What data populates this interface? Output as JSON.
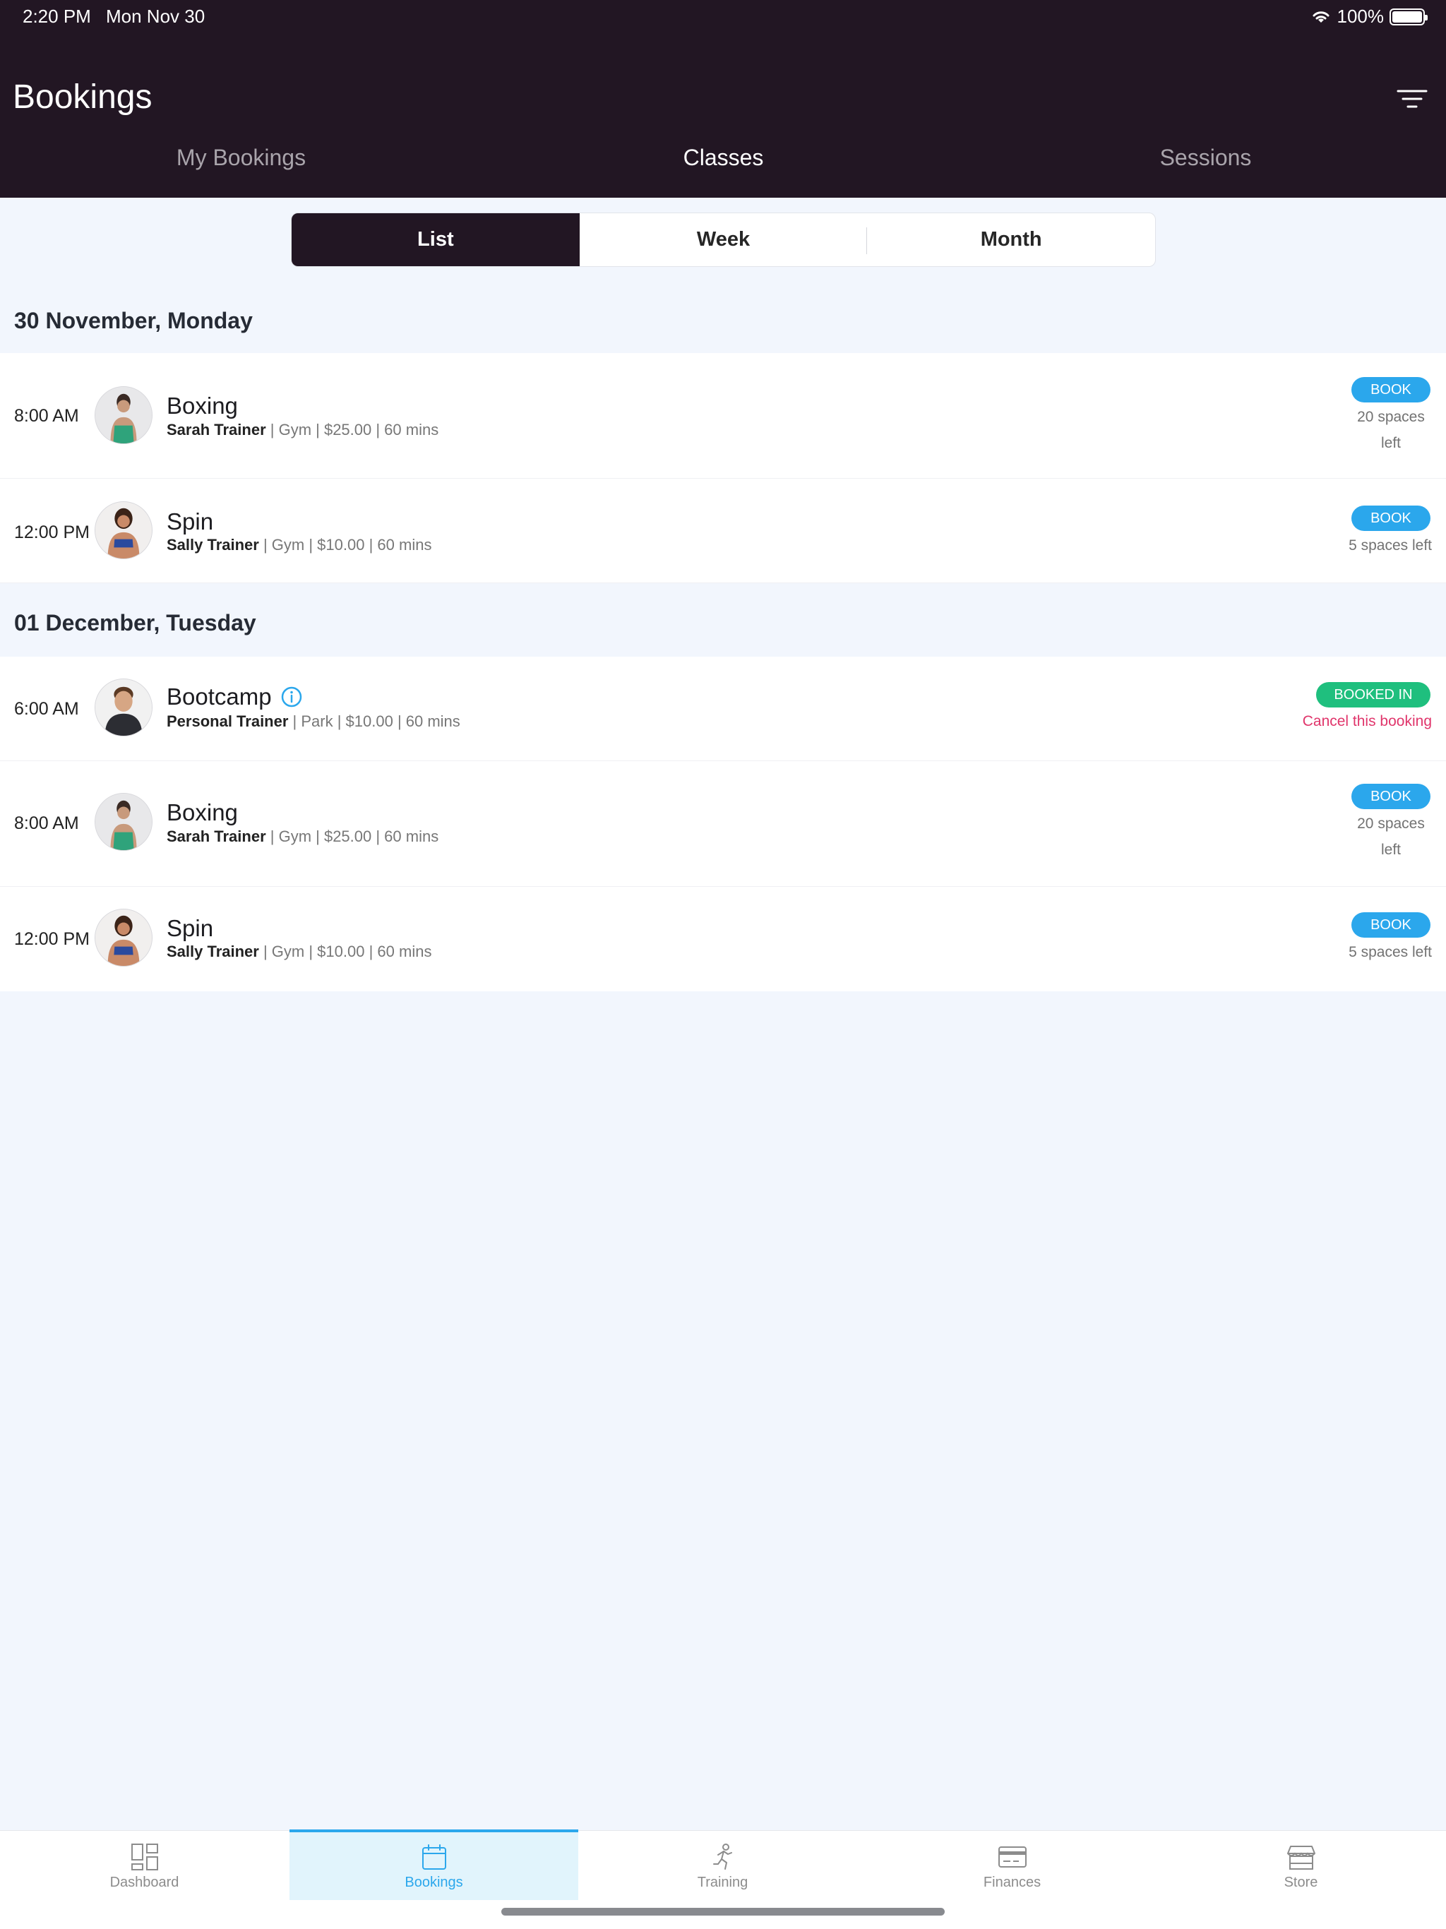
{
  "status": {
    "time": "2:20 PM",
    "date": "Mon Nov 30",
    "battery": "100%"
  },
  "header": {
    "title": "Bookings"
  },
  "tabs": [
    {
      "label": "My Bookings",
      "active": false
    },
    {
      "label": "Classes",
      "active": true
    },
    {
      "label": "Sessions",
      "active": false
    }
  ],
  "view_modes": [
    {
      "label": "List",
      "active": true
    },
    {
      "label": "Week",
      "active": false
    },
    {
      "label": "Month",
      "active": false
    }
  ],
  "days": [
    {
      "heading": "30 November, Monday",
      "classes": [
        {
          "time": "8:00 AM",
          "title": "Boxing",
          "trainer": "Sarah Trainer",
          "details": " | Gym | $25.00 | 60 mins",
          "action": "BOOK",
          "spaces": "20 spaces left"
        },
        {
          "time": "12:00 PM",
          "title": "Spin",
          "trainer": "Sally Trainer",
          "details": " | Gym | $10.00 | 60 mins",
          "action": "BOOK",
          "spaces": "5 spaces left"
        }
      ]
    },
    {
      "heading": "01 December, Tuesday",
      "classes": [
        {
          "time": "6:00 AM",
          "title": "Bootcamp",
          "trainer": "Personal Trainer",
          "details": " | Park | $10.00 | 60 mins",
          "action": "BOOKED IN",
          "cancel": "Cancel this booking"
        },
        {
          "time": "8:00 AM",
          "title": "Boxing",
          "trainer": "Sarah Trainer",
          "details": " | Gym | $25.00 | 60 mins",
          "action": "BOOK",
          "spaces": "20 spaces left"
        },
        {
          "time": "12:00 PM",
          "title": "Spin",
          "trainer": "Sally Trainer",
          "details": " | Gym | $10.00 | 60 mins",
          "action": "BOOK",
          "spaces": "5 spaces left"
        }
      ]
    }
  ],
  "bottom_nav": [
    {
      "label": "Dashboard",
      "icon": "dashboard-icon",
      "active": false
    },
    {
      "label": "Bookings",
      "icon": "calendar-icon",
      "active": true
    },
    {
      "label": "Training",
      "icon": "running-icon",
      "active": false
    },
    {
      "label": "Finances",
      "icon": "credit-card-icon",
      "active": false
    },
    {
      "label": "Store",
      "icon": "store-icon",
      "active": false
    }
  ],
  "colors": {
    "header_bg": "#221623",
    "accent": "#2ba7ec",
    "booked": "#1fbf7e",
    "cancel": "#e0356b",
    "page_bg": "#f2f6fd"
  }
}
